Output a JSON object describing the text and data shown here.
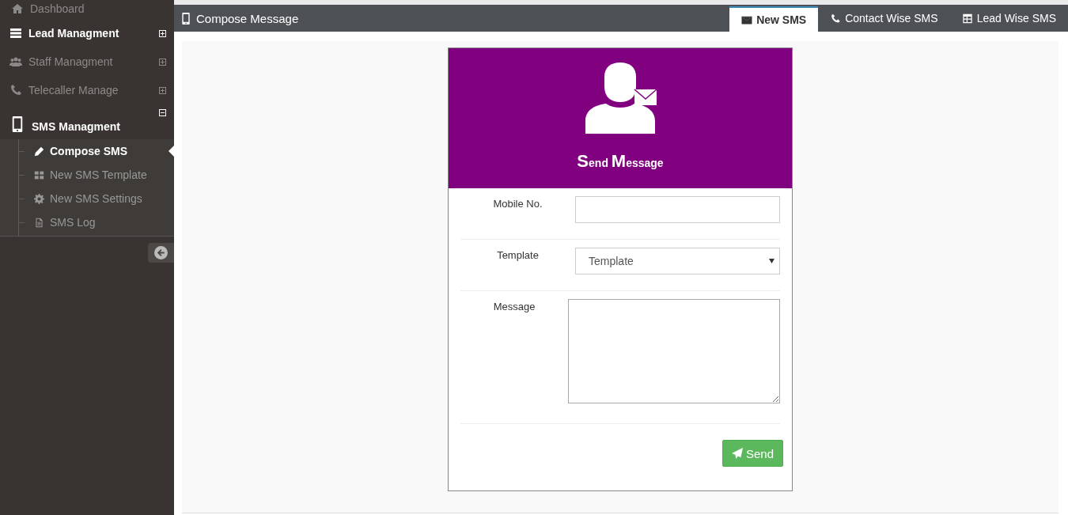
{
  "sidebar": {
    "items": [
      {
        "label": "Dashboard",
        "highlighted": false
      },
      {
        "label": "Lead Managment",
        "highlighted": true,
        "expanded": false
      },
      {
        "label": "Staff Managment",
        "highlighted": false,
        "expanded": false
      },
      {
        "label": "Telecaller Manage",
        "highlighted": false,
        "expanded": false
      },
      {
        "label": "SMS Managment",
        "highlighted": true,
        "expanded": true,
        "children": [
          {
            "label": "Compose SMS",
            "selected": true
          },
          {
            "label": "New SMS Template",
            "selected": false
          },
          {
            "label": "New SMS Settings",
            "selected": false
          },
          {
            "label": "SMS Log",
            "selected": false
          }
        ]
      }
    ]
  },
  "header": {
    "title": "Compose Message",
    "tabs": [
      {
        "label": "New SMS",
        "selected": true
      },
      {
        "label": "Contact Wise SMS",
        "selected": false
      },
      {
        "label": "Lead Wise SMS",
        "selected": false
      }
    ]
  },
  "form": {
    "title": "Send Message",
    "fields": [
      {
        "label": "Mobile No.",
        "kind": "text"
      },
      {
        "label": "Template",
        "kind": "select",
        "value": "Template"
      },
      {
        "label": "Message",
        "kind": "textarea"
      }
    ],
    "button": "Send"
  }
}
